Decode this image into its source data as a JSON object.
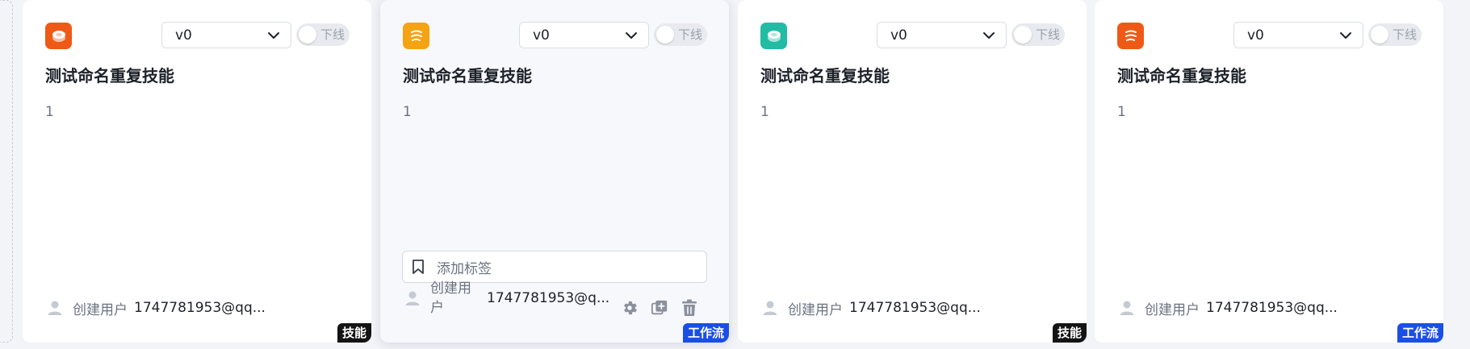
{
  "colors": {
    "accent_blue": "#1a4fe6",
    "skill_badge": "#141414",
    "icon_orange_red": "#ee5a16",
    "icon_amber": "#f5a312",
    "icon_teal": "#22bba4"
  },
  "cards": [
    {
      "icon": "stack-disc-icon",
      "version": "v0",
      "toggle_label": "下线",
      "title": "测试命名重复技能",
      "description": "1",
      "creator_label": "创建用户",
      "creator_value": "1747781953@qq...",
      "badge": "技能"
    },
    {
      "icon": "waves-icon",
      "version": "v0",
      "toggle_label": "下线",
      "title": "测试命名重复技能",
      "description": "1",
      "tag_placeholder": "添加标签",
      "creator_label": "创建用户",
      "creator_value": "1747781953@q...",
      "actions": [
        "settings-icon",
        "copy-add-icon",
        "trash-icon"
      ],
      "badge": "工作流"
    },
    {
      "icon": "stack-disc-icon",
      "version": "v0",
      "toggle_label": "下线",
      "title": "测试命名重复技能",
      "description": "1",
      "creator_label": "创建用户",
      "creator_value": "1747781953@qq...",
      "badge": "技能"
    },
    {
      "icon": "waves-icon",
      "version": "v0",
      "toggle_label": "下线",
      "title": "测试命名重复技能",
      "description": "1",
      "creator_label": "创建用户",
      "creator_value": "1747781953@qq...",
      "badge": "工作流"
    }
  ]
}
